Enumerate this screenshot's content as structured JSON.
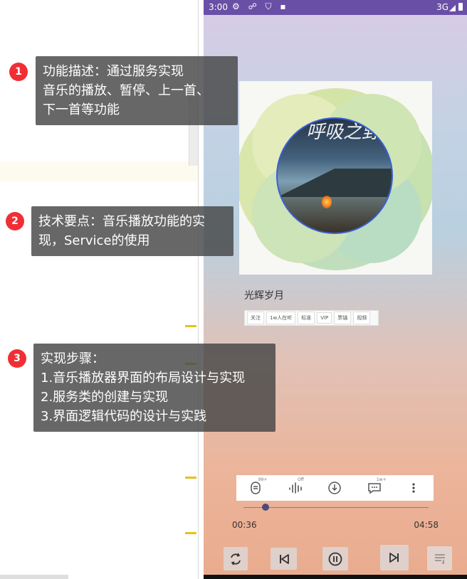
{
  "callouts": [
    {
      "number": "1",
      "lines": [
        "功能描述：通过服务实现",
        "音乐的播放、暂停、上一首、",
        "下一首等功能"
      ]
    },
    {
      "number": "2",
      "lines": [
        "技术要点：音乐播放功能的实",
        "现，Service的使用"
      ]
    },
    {
      "number": "3",
      "lines": [
        "实现步骤：",
        "1.音乐播放器界面的布局设计与实现",
        "2.服务类的创建与实现",
        "3.界面逻辑代码的设计与实践"
      ]
    }
  ],
  "status_bar": {
    "time": "3:00",
    "network": "3G"
  },
  "album_cover": {
    "title_text": "呼吸之野"
  },
  "song": {
    "title": "光辉岁月"
  },
  "tags": [
    "关注",
    "1w人在听",
    "标准",
    "VIP",
    "票锚",
    "视频"
  ],
  "actions": {
    "like_badge": "99+",
    "effect_badge": "Off",
    "comment_badge": "1w+"
  },
  "player": {
    "current_time": "00:36",
    "total_time": "04:58",
    "progress": 0.12
  },
  "colors": {
    "status_bar": "#6a4fa6",
    "seek_thumb": "#4c4a7a",
    "badge": "#ef2f35"
  }
}
